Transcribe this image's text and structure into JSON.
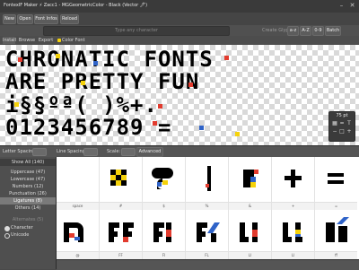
{
  "window": {
    "title": "FontexIF Maker ⚡ Zacc1 - MGGeometricColor - Black (Vector 🖊)",
    "close_glyph": "✕",
    "min_glyph": "–"
  },
  "toolbar": {
    "new_label": "New",
    "open_label": "Open",
    "font_infos_label": "Font Infos",
    "reload_label": "Reload"
  },
  "typebar": {
    "placeholder": "Type any character",
    "create_glyph_label": "Create Glyph",
    "a_label": "a-z",
    "A_label": "A-Z",
    "digits_label": "0-9",
    "batch_label": "Batch"
  },
  "tabs": {
    "install": "Install",
    "browse": "Browse",
    "export": "Export",
    "color_font": "Color Font"
  },
  "preview": {
    "lines": [
      "CHRONATIC FONTS",
      "ARE PRETTY FUN",
      "i§§ºª( )%+.",
      "0123456789 ="
    ],
    "zoom": "75 pt"
  },
  "controls": {
    "letter_spacing_label": "Letter Spacing:",
    "line_spacing_label": "Line Spacing:",
    "scale_label": "Scale:",
    "advanced_label": "Advanced"
  },
  "sidebar": {
    "show_all": "Show All (140)",
    "categories": [
      "Uppercase (47)",
      "Lowercase (47)",
      "Numbers (12)",
      "Punctuation (26)",
      "Ligatures (8)",
      "Others (14)"
    ],
    "alternates": "Alternates (5)",
    "character_label": "Character",
    "unicode_label": "Unicode"
  },
  "glyphs": {
    "row1": [
      {
        "label": "space"
      },
      {
        "label": "#"
      },
      {
        "label": "$"
      },
      {
        "label": "%"
      },
      {
        "label": "&"
      },
      {
        "label": "+"
      },
      {
        "label": "="
      }
    ],
    "row2": [
      {
        "label": "@"
      },
      {
        "label": "FF"
      },
      {
        "label": "FI"
      },
      {
        "label": "FL"
      },
      {
        "label": "LI"
      },
      {
        "label": "Ll"
      },
      {
        "label": "ff"
      }
    ],
    "row2_small": [
      "",
      "liga",
      "liga",
      "liga",
      "liga",
      "liga",
      "liga"
    ]
  },
  "bottom": {
    "status": ""
  },
  "colors": {
    "red": "#e23b2e",
    "yellow": "#f5d20a",
    "blue": "#2f63c8",
    "black": "#000000"
  }
}
